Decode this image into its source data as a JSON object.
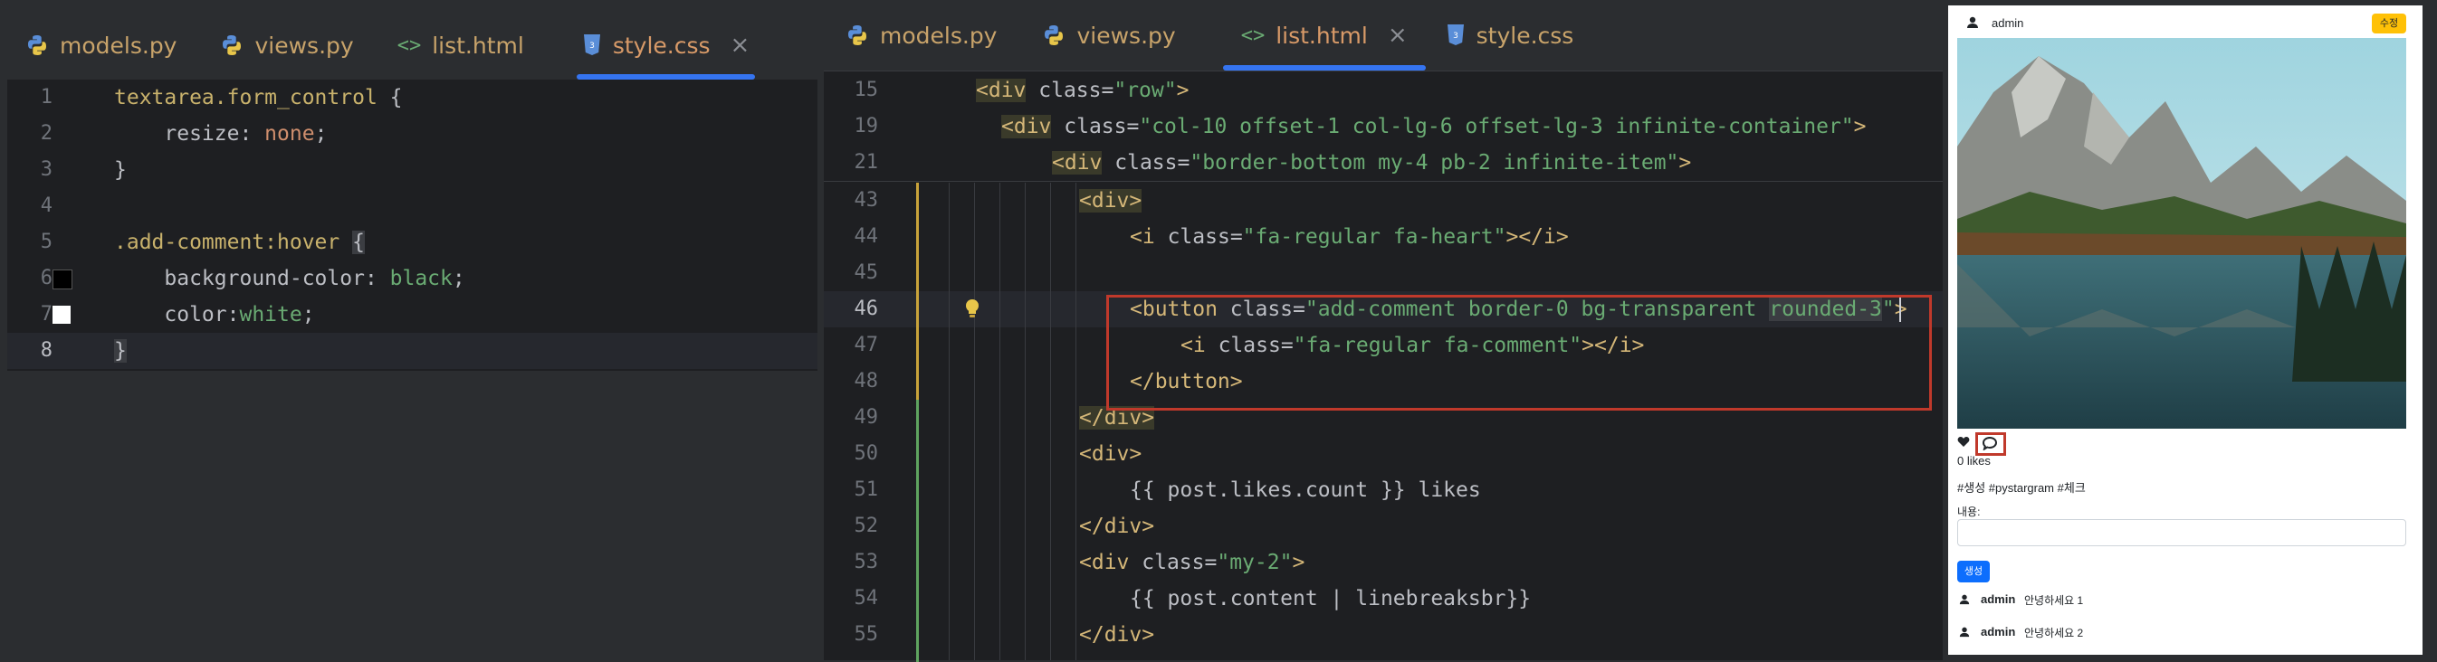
{
  "left_editor": {
    "tabs": [
      {
        "label": "models.py",
        "icon": "python-icon",
        "active": false
      },
      {
        "label": "views.py",
        "icon": "python-icon",
        "active": false
      },
      {
        "label": "list.html",
        "icon": "html-icon",
        "active": false
      },
      {
        "label": "style.css",
        "icon": "css-icon",
        "active": true
      }
    ],
    "lines": [
      {
        "num": "1",
        "text": "textarea.form_control {"
      },
      {
        "num": "2",
        "text": "    resize: none;"
      },
      {
        "num": "3",
        "text": "}"
      },
      {
        "num": "4",
        "text": ""
      },
      {
        "num": "5",
        "text": ".add-comment:hover {"
      },
      {
        "num": "6",
        "text": "    background-color: black;"
      },
      {
        "num": "7",
        "text": "    color:white;"
      },
      {
        "num": "8",
        "text": "}"
      }
    ],
    "swatch_colors": {
      "black": "#000000",
      "white": "#ffffff"
    }
  },
  "mid_editor": {
    "tabs": [
      {
        "label": "models.py",
        "icon": "python-icon",
        "active": false
      },
      {
        "label": "views.py",
        "icon": "python-icon",
        "active": false
      },
      {
        "label": "list.html",
        "icon": "html-icon",
        "active": true
      },
      {
        "label": "style.css",
        "icon": "css-icon",
        "active": false
      }
    ],
    "sticky_lines": [
      {
        "num": "15",
        "text": "<div class=\"row\">"
      },
      {
        "num": "19",
        "text": "<div class=\"col-10 offset-1 col-lg-6 offset-lg-3 infinite-container\">"
      },
      {
        "num": "21",
        "text": "<div class=\"border-bottom my-4 pb-2 infinite-item\">"
      }
    ],
    "lines": [
      {
        "num": "43",
        "text": "<div>"
      },
      {
        "num": "44",
        "text": "<i class=\"fa-regular fa-heart\"></i>"
      },
      {
        "num": "45",
        "text": ""
      },
      {
        "num": "46",
        "text": "<button class=\"add-comment border-0 bg-transparent rounded-3\">"
      },
      {
        "num": "47",
        "text": "<i class=\"fa-regular fa-comment\"></i>"
      },
      {
        "num": "48",
        "text": "</button>"
      },
      {
        "num": "49",
        "text": "</div>"
      },
      {
        "num": "50",
        "text": "<div>"
      },
      {
        "num": "51",
        "text": "{{ post.likes.count }} likes"
      },
      {
        "num": "52",
        "text": "</div>"
      },
      {
        "num": "53",
        "text": "<div class=\"my-2\">"
      },
      {
        "num": "54",
        "text": "{{ post.content | linebreaksbr}}"
      },
      {
        "num": "55",
        "text": "</div>"
      }
    ]
  },
  "preview": {
    "author": "admin",
    "edit_button": "수정",
    "likes": "0 likes",
    "tags": "#생성 #pystargram #체크",
    "content_label": "내용:",
    "submit_button": "생성",
    "comments": [
      {
        "user": "admin",
        "text": "안녕하세요 1"
      },
      {
        "user": "admin",
        "text": "안녕하세요 2"
      }
    ],
    "colors": {
      "edit_button_bg": "#ffc107",
      "submit_button_bg": "#0d6efd",
      "highlight_box": "#c0392b"
    }
  }
}
